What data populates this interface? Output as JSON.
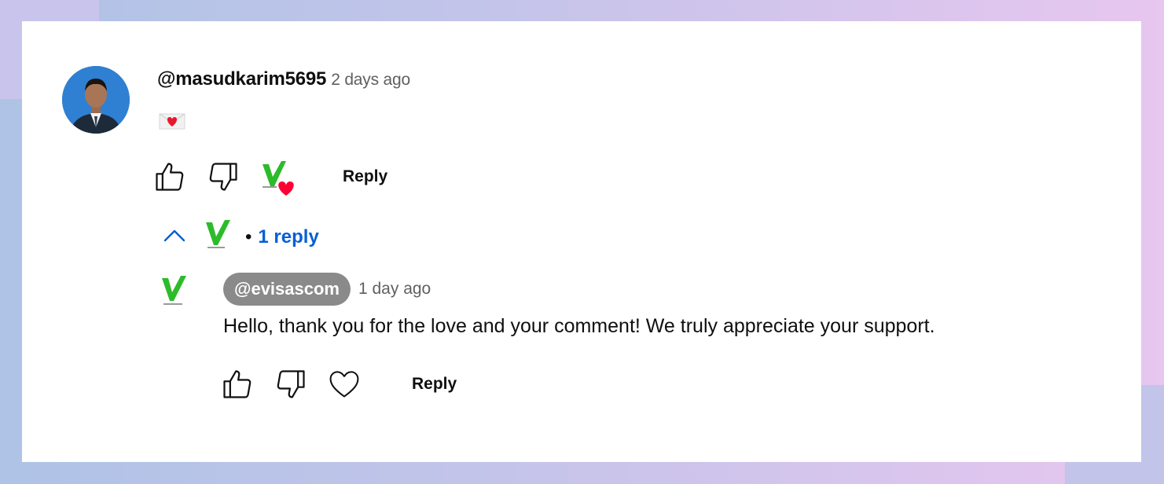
{
  "comment": {
    "author": "@masudkarim5695",
    "time": "2 days ago",
    "message_icon": "love-letter-emoji",
    "actions": {
      "like_icon": "thumbs-up-icon",
      "dislike_icon": "thumbs-down-icon",
      "creator_heart_icon": "creator-heart-icon",
      "reply_label": "Reply"
    }
  },
  "replies_toggle": {
    "icon": "chevron-up-icon",
    "count_label": "1 reply"
  },
  "reply": {
    "author": "@evisascom",
    "time": "1 day ago",
    "text": "Hello, thank you for the love and your comment! We truly appreciate your support.",
    "actions": {
      "like_icon": "thumbs-up-icon",
      "dislike_icon": "thumbs-down-icon",
      "heart_icon": "heart-outline-icon",
      "reply_label": "Reply"
    }
  },
  "colors": {
    "link_blue": "#065fd4",
    "brand_green": "#2dbb2a",
    "heart_red": "#ff0033",
    "chip_gray": "#8a8a8a"
  }
}
